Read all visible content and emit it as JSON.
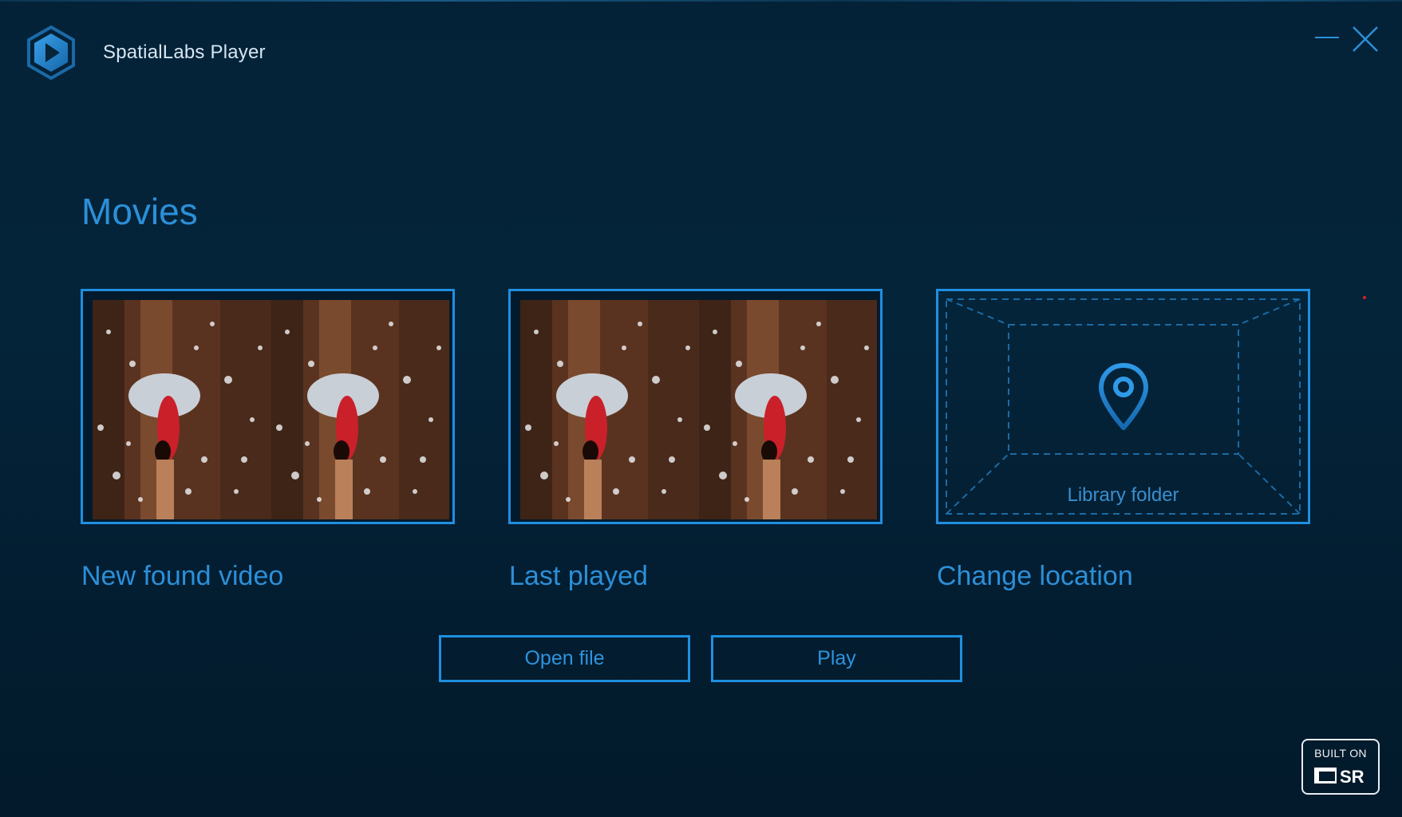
{
  "window": {
    "title": "SpatialLabs Player",
    "controls": {
      "minimize": "minimize-icon",
      "close": "close-icon"
    }
  },
  "page": {
    "section_title": "Movies"
  },
  "cards": [
    {
      "caption": "New found video",
      "thumbnail": "video-thumbnail"
    },
    {
      "caption": "Last played",
      "thumbnail": "video-thumbnail"
    },
    {
      "caption": "Change location",
      "folder_label": "Library folder",
      "icon": "location-pin-icon"
    }
  ],
  "buttons": {
    "open_file": "Open file",
    "play": "Play"
  },
  "badge": {
    "top_text": "BUILT ON",
    "logo_text": "SR"
  },
  "colors": {
    "accent": "#1f8fe0",
    "text_accent": "#2c8fd8",
    "background": "#04243a"
  }
}
